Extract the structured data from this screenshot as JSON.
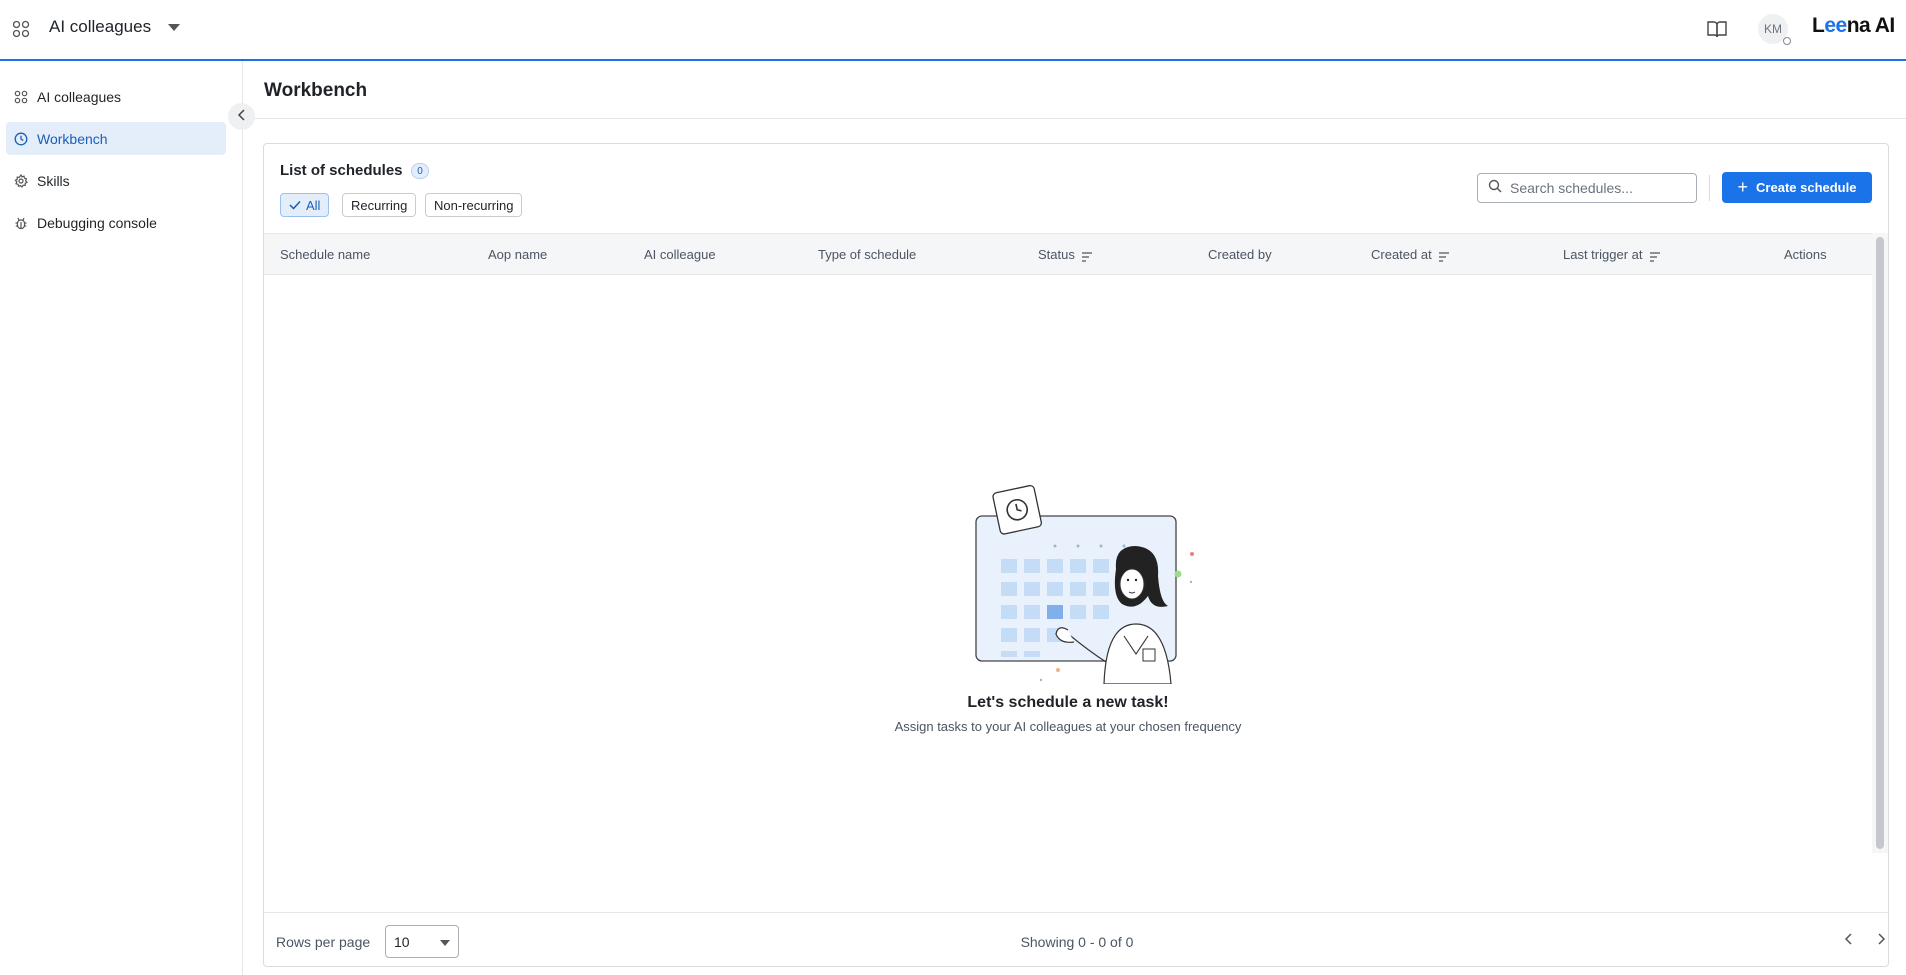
{
  "header": {
    "app_title": "AI colleagues",
    "avatar_initials": "KM",
    "logo_text_pre": "L",
    "logo_text_hi": "ee",
    "logo_text_post": "na AI"
  },
  "sidebar": {
    "items": [
      {
        "label": "AI colleagues",
        "icon": "ai-colleagues-icon",
        "active": false
      },
      {
        "label": "Workbench",
        "icon": "clock-icon",
        "active": true
      },
      {
        "label": "Skills",
        "icon": "gear-icon",
        "active": false
      },
      {
        "label": "Debugging console",
        "icon": "bug-icon",
        "active": false
      }
    ]
  },
  "main": {
    "page_title": "Workbench",
    "list_title": "List of schedules",
    "count": "0",
    "filters": [
      "All",
      "Recurring",
      "Non-recurring"
    ],
    "search_placeholder": "Search schedules...",
    "create_label": "Create schedule",
    "columns": [
      "Schedule name",
      "Aop name",
      "AI colleague",
      "Type of schedule",
      "Status",
      "Created by",
      "Created at",
      "Last trigger at",
      "Actions"
    ],
    "empty_title": "Let's schedule a new task!",
    "empty_subtitle": "Assign tasks to your AI colleagues at your chosen frequency",
    "rows_per_page_label": "Rows per page",
    "rows_per_page_value": "10",
    "showing": "Showing 0 - 0 of 0"
  },
  "colors": {
    "accent": "#1a73e8",
    "active_bg": "#e4eefb"
  }
}
